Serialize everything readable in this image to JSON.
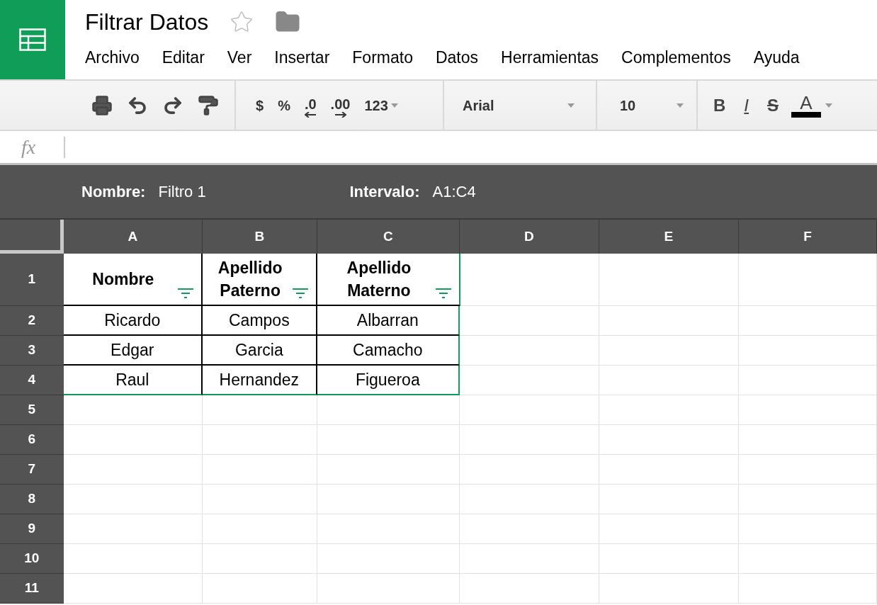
{
  "document": {
    "title": "Filtrar Datos",
    "starred": false
  },
  "menu": [
    "Archivo",
    "Editar",
    "Ver",
    "Insertar",
    "Formato",
    "Datos",
    "Herramientas",
    "Complementos",
    "Ayuda"
  ],
  "toolbar": {
    "number_formats": [
      {
        "label": "$",
        "kind": "plain"
      },
      {
        "label": "%",
        "kind": "plain"
      },
      {
        "label": ".0",
        "kind": "decrease"
      },
      {
        "label": ".00",
        "kind": "increase"
      },
      {
        "label": "123",
        "kind": "dropdown"
      }
    ],
    "font": "Arial",
    "font_size": "10",
    "text_styles": [
      {
        "label": "B",
        "kind": "bold"
      },
      {
        "label": "I",
        "kind": "italic"
      },
      {
        "label": "S",
        "kind": "strike"
      },
      {
        "label": "A",
        "kind": "color",
        "color": "#000000"
      }
    ]
  },
  "formula_bar": {
    "label": "fx"
  },
  "filter_bar": {
    "name_label": "Nombre:",
    "name": "Filtro 1",
    "range_label": "Intervalo:",
    "range": "A1:C4"
  },
  "grid": {
    "columns": [
      "A",
      "B",
      "C",
      "D",
      "E",
      "F"
    ],
    "rows": [
      {
        "number": "1",
        "kind": "header",
        "cells": [
          {
            "text": "Nombre",
            "filter": true
          },
          {
            "text": "Apellido Paterno",
            "filter": true
          },
          {
            "text": "Apellido Materno",
            "filter": true
          }
        ]
      },
      {
        "number": "2",
        "kind": "data",
        "cells": [
          {
            "text": "Ricardo"
          },
          {
            "text": "Campos"
          },
          {
            "text": "Albarran"
          }
        ]
      },
      {
        "number": "3",
        "kind": "data",
        "cells": [
          {
            "text": "Edgar"
          },
          {
            "text": "Garcia"
          },
          {
            "text": "Camacho"
          }
        ]
      },
      {
        "number": "4",
        "kind": "data",
        "cells": [
          {
            "text": "Raul"
          },
          {
            "text": "Hernandez"
          },
          {
            "text": "Figueroa"
          }
        ]
      },
      {
        "number": "5",
        "kind": "data"
      },
      {
        "number": "6",
        "kind": "data"
      },
      {
        "number": "7",
        "kind": "data"
      },
      {
        "number": "8",
        "kind": "data"
      },
      {
        "number": "9",
        "kind": "data"
      },
      {
        "number": "10",
        "kind": "data"
      },
      {
        "number": "11",
        "kind": "data"
      }
    ]
  }
}
